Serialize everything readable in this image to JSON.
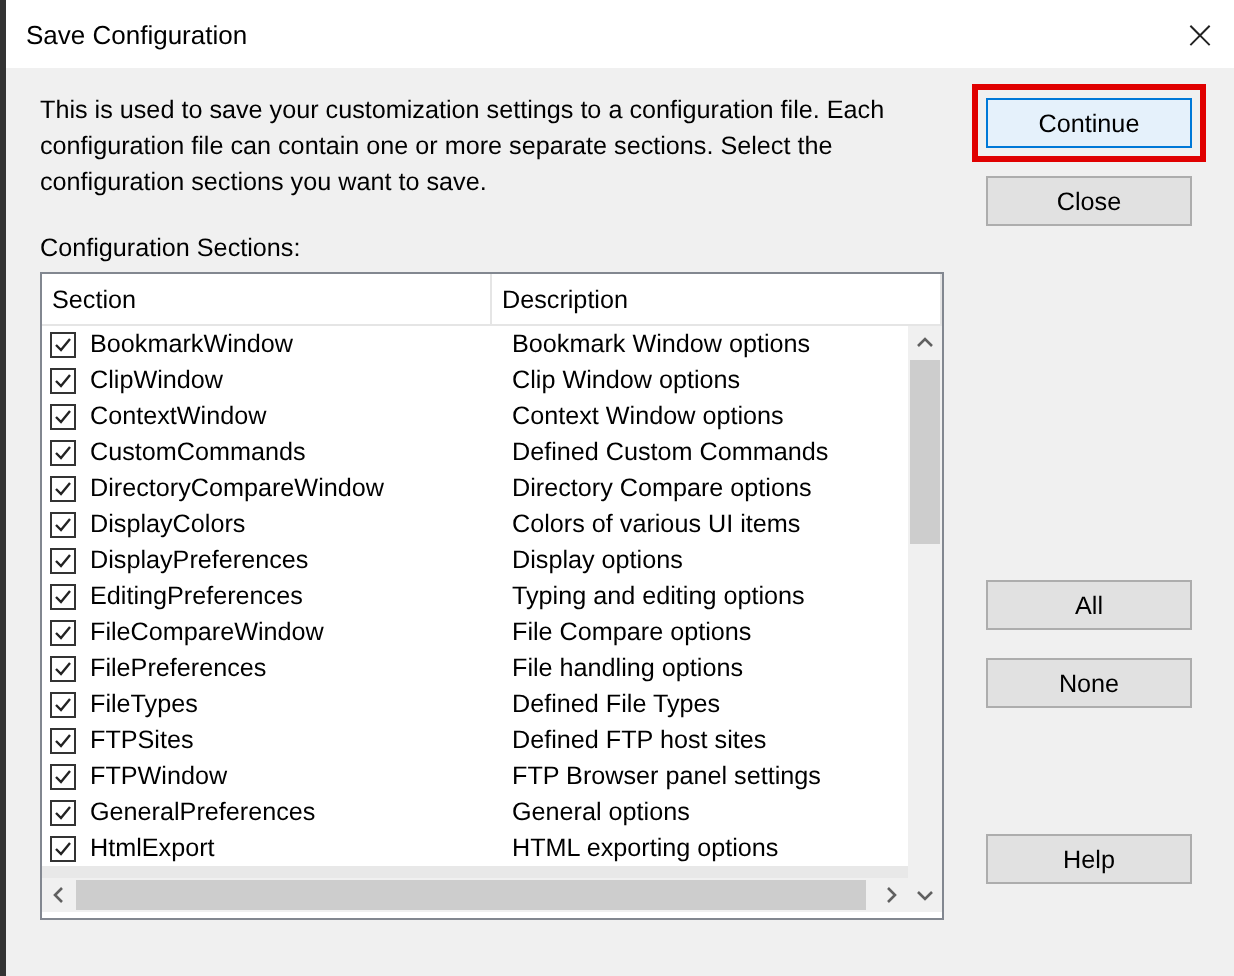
{
  "window": {
    "title": "Save Configuration",
    "close": "×"
  },
  "intro": "This is used to save your customization settings to a configuration file. Each configuration file can contain one or more separate sections. Select the configuration sections you want to save.",
  "list_label": "Configuration Sections:",
  "columns": [
    "Section",
    "Description"
  ],
  "sections": [
    {
      "name": "BookmarkWindow",
      "description": "Bookmark Window options",
      "checked": true
    },
    {
      "name": "ClipWindow",
      "description": "Clip Window options",
      "checked": true
    },
    {
      "name": "ContextWindow",
      "description": "Context Window options",
      "checked": true
    },
    {
      "name": "CustomCommands",
      "description": "Defined Custom Commands",
      "checked": true
    },
    {
      "name": "DirectoryCompareWindow",
      "description": "Directory Compare options",
      "checked": true
    },
    {
      "name": "DisplayColors",
      "description": "Colors of various UI items",
      "checked": true
    },
    {
      "name": "DisplayPreferences",
      "description": "Display options",
      "checked": true
    },
    {
      "name": "EditingPreferences",
      "description": "Typing and editing options",
      "checked": true
    },
    {
      "name": "FileCompareWindow",
      "description": "File Compare options",
      "checked": true
    },
    {
      "name": "FilePreferences",
      "description": "File handling options",
      "checked": true
    },
    {
      "name": "FileTypes",
      "description": "Defined File Types",
      "checked": true
    },
    {
      "name": "FTPSites",
      "description": "Defined FTP host sites",
      "checked": true
    },
    {
      "name": "FTPWindow",
      "description": "FTP Browser panel settings",
      "checked": true
    },
    {
      "name": "GeneralPreferences",
      "description": "General options",
      "checked": true
    },
    {
      "name": "HtmlExport",
      "description": "HTML exporting options",
      "checked": true
    }
  ],
  "buttons": [
    {
      "label": "Continue",
      "highlighted": true,
      "default": true
    },
    {
      "label": "Close",
      "highlighted": false,
      "default": false
    },
    {
      "label": "All",
      "highlighted": false,
      "default": false
    },
    {
      "label": "None",
      "highlighted": false,
      "default": false
    },
    {
      "label": "Help",
      "highlighted": false,
      "default": false
    }
  ]
}
